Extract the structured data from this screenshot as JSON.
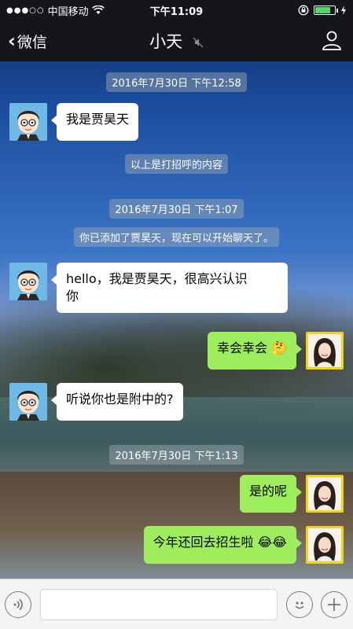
{
  "status_bar": {
    "carrier": "中国移动",
    "time": "下午11:09"
  },
  "nav": {
    "back_label": "微信",
    "title": "小天"
  },
  "messages": [
    {
      "type": "timestamp",
      "text": "2016年7月30日 下午12:58"
    },
    {
      "type": "received",
      "text": "我是贾昊天"
    },
    {
      "type": "system",
      "text": "以上是打招呼的内容"
    },
    {
      "type": "timestamp",
      "text": "2016年7月30日 下午1:07"
    },
    {
      "type": "system",
      "text": "你已添加了贾昊天，现在可以开始聊天了。"
    },
    {
      "type": "received",
      "line1": "hello，我是贾昊天，很高兴认识",
      "line2": "你"
    },
    {
      "type": "sent",
      "text": "幸会幸会"
    },
    {
      "type": "received",
      "text": "听说你也是附中的?"
    },
    {
      "type": "timestamp",
      "text": "2016年7月30日 下午1:13"
    },
    {
      "type": "sent",
      "text": "是的呢"
    },
    {
      "type": "sent",
      "text": "今年还回去招生啦"
    }
  ],
  "icons": {
    "voice": "voice-icon",
    "emoji": "emoji-icon",
    "plus": "plus-icon"
  },
  "colors": {
    "sent_bubble": "#9ded5c",
    "received_bubble": "#ffffff",
    "bar": "#14161b"
  }
}
